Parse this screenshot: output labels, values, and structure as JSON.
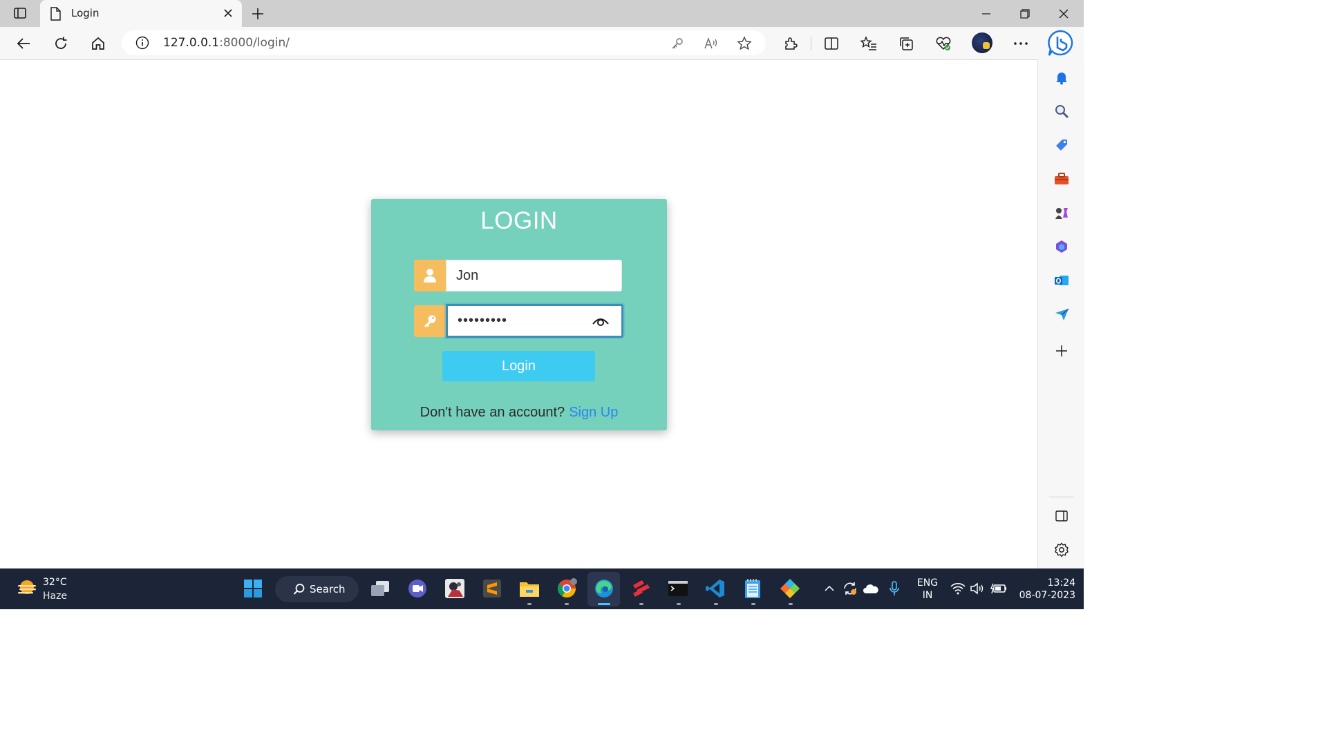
{
  "browser": {
    "tab_title": "Login",
    "url_host": "127.0.0.1",
    "url_path": ":8000/login/"
  },
  "login_form": {
    "heading": "LOGIN",
    "username_value": "Jon",
    "password_value": "•••••••••",
    "submit_label": "Login",
    "signup_prompt": "Don't have an account?",
    "signup_link": "Sign Up",
    "colors": {
      "card": "#75d0bc",
      "icon_bg": "#f5bd5d",
      "button": "#3ecbf2",
      "link": "#2b86f0"
    }
  },
  "toolbar_icons": [
    "back-icon",
    "refresh-icon",
    "home-icon",
    "info-icon",
    "key-icon",
    "read-aloud-icon",
    "favorite-star-icon",
    "extensions-icon",
    "split-screen-icon",
    "favorites-icon",
    "collections-icon",
    "browser-essentials-icon",
    "profile-avatar",
    "more-icon",
    "bing-copilot-icon"
  ],
  "sidebar_icons": [
    "notifications-icon",
    "search-icon",
    "shopping-icon",
    "tools-icon",
    "games-icon",
    "microsoft-365-icon",
    "outlook-icon",
    "drop-icon",
    "add-icon",
    "hide-sidebar-icon",
    "settings-icon"
  ],
  "taskbar": {
    "weather_temp": "32°C",
    "weather_condition": "Haze",
    "search_label": "Search",
    "language_line1": "ENG",
    "language_line2": "IN",
    "time": "13:24",
    "date": "08-07-2023"
  }
}
